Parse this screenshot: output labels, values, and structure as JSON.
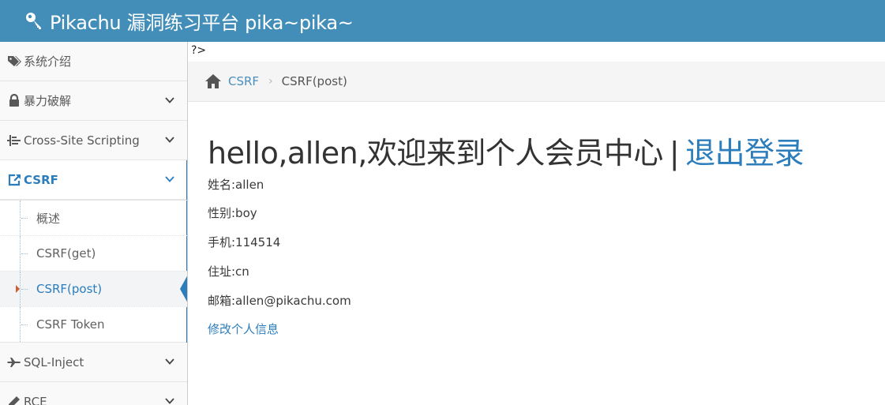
{
  "colors": {
    "navbar": "#438eb9",
    "accent": "#2b7dbc",
    "sidebar_bg": "#f2f2f2",
    "caret": "#c86139"
  },
  "navbar": {
    "brand_icon": "key-icon",
    "title": "Pikachu 漏洞练习平台 pika~pika~"
  },
  "sidebar": {
    "items": [
      {
        "label": "系统介绍",
        "icon": "tag-icon"
      },
      {
        "label": "暴力破解",
        "icon": "lock-icon"
      },
      {
        "label": "Cross-Site Scripting",
        "icon": "list-icon"
      },
      {
        "label": "CSRF",
        "icon": "share-square-icon"
      },
      {
        "label": "SQL-Inject",
        "icon": "plane-icon"
      },
      {
        "label": "RCE",
        "icon": "pencil-icon"
      }
    ],
    "csrf_submenu": [
      {
        "label": "概述"
      },
      {
        "label": "CSRF(get)"
      },
      {
        "label": "CSRF(post)"
      },
      {
        "label": "CSRF Token"
      }
    ]
  },
  "main": {
    "stray_text": "?>",
    "breadcrumbs": {
      "home_icon": "home-icon",
      "link": "CSRF",
      "separator": "›",
      "current": "CSRF(post)"
    },
    "greeting": "hello,allen,欢迎来到个人会员中心",
    "divider": "|",
    "logout": "退出登录",
    "profile": [
      {
        "text": "姓名:allen"
      },
      {
        "text": "性别:boy"
      },
      {
        "text": "手机:114514"
      },
      {
        "text": "住址:cn"
      },
      {
        "text": "邮箱:allen@pikachu.com"
      }
    ],
    "edit_link": "修改个人信息"
  }
}
